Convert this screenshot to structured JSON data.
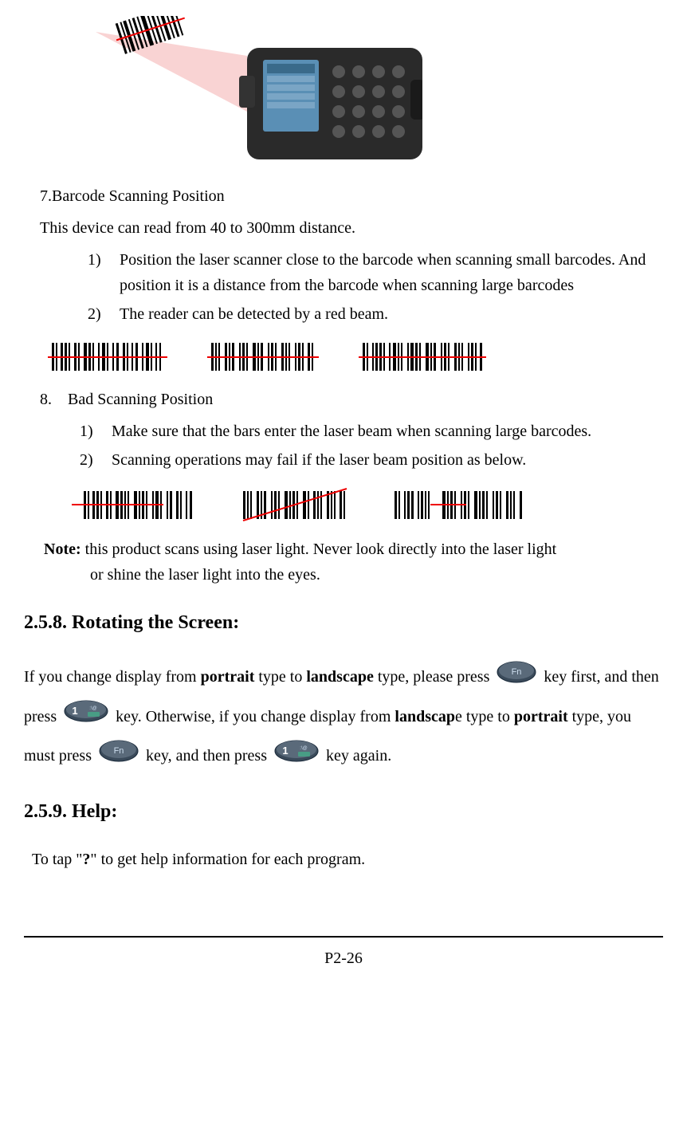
{
  "section7": {
    "title": "7.Barcode Scanning Position",
    "intro": "This device can read from 40 to 300mm distance.",
    "items": [
      {
        "marker": "1)",
        "text": "Position the laser scanner close to the barcode when scanning small barcodes. And position it is a distance from the barcode when scanning large barcodes"
      },
      {
        "marker": "2)",
        "text": "The reader can be detected by a red beam."
      }
    ]
  },
  "section8": {
    "title_num": "8.",
    "title_text": "Bad Scanning Position",
    "items": [
      {
        "marker": "1)",
        "text": "Make sure that the bars enter the laser beam when scanning large barcodes."
      },
      {
        "marker": "2)",
        "text": "Scanning operations may fail if the laser beam position as below."
      }
    ]
  },
  "note": {
    "label": "Note:",
    "line1": " this product scans using laser light. Never look directly into the laser light",
    "line2": "or shine the laser light into the eyes."
  },
  "heading258": "2.5.8. Rotating the Screen:",
  "rotate_text": {
    "p1a": "If you change display from ",
    "p1b": "portrait",
    "p1c": " type to ",
    "p1d": "landscape",
    "p1e": " type, please press ",
    "p1f": " key first, and then press",
    "p1g": " key. Otherwise, if you change display from ",
    "p1h": "landscap",
    "p1i": "e type to ",
    "p1j": "portrait",
    "p1k": " type, you must press ",
    "p1l": " key, and then press ",
    "p1m": " key again."
  },
  "heading259": "2.5.9. Help:",
  "help_text": {
    "a": " To tap \"",
    "b": "?",
    "c": "\" to get help information for each program."
  },
  "page_number": "P2-26",
  "key_labels": {
    "fn": "Fn",
    "one": "1"
  }
}
